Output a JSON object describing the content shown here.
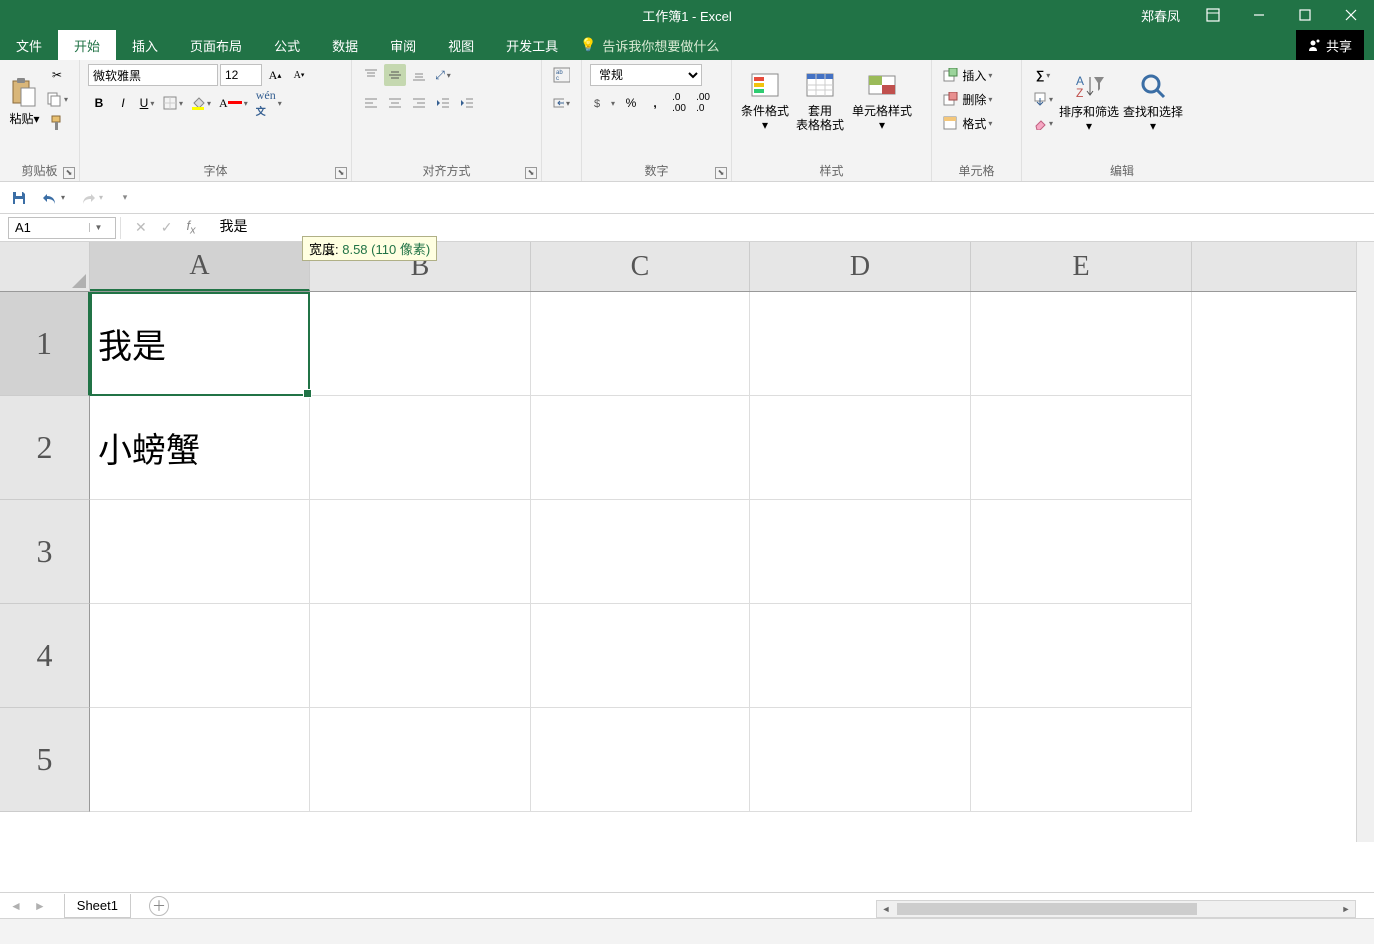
{
  "title": "工作簿1 - Excel",
  "user": "郑春凤",
  "tabs": {
    "file": "文件",
    "home": "开始",
    "insert": "插入",
    "layout": "页面布局",
    "formulas": "公式",
    "data": "数据",
    "review": "审阅",
    "view": "视图",
    "dev": "开发工具",
    "tellme": "告诉我你想要做什么"
  },
  "share": "共享",
  "ribbon": {
    "clipboard": {
      "paste": "粘贴",
      "label": "剪贴板"
    },
    "font": {
      "name": "微软雅黑",
      "size": "12",
      "label": "字体"
    },
    "align": {
      "label": "对齐方式"
    },
    "number": {
      "format": "常规",
      "label": "数字"
    },
    "styles": {
      "cond": "条件格式",
      "table": "套用\n表格格式",
      "cell": "单元格样式",
      "label": "样式"
    },
    "cells": {
      "insert": "插入",
      "delete": "删除",
      "format": "格式",
      "label": "单元格"
    },
    "editing": {
      "sort": "排序和筛选",
      "find": "查找和选择",
      "label": "编辑"
    }
  },
  "namebox": "A1",
  "formula": "我是",
  "tooltip": {
    "prefix": "宽度: ",
    "value": "8.58 (110 像素)"
  },
  "columns": [
    "A",
    "B",
    "C",
    "D",
    "E"
  ],
  "rows": [
    "1",
    "2",
    "3",
    "4",
    "5"
  ],
  "cells": {
    "A1": "我是",
    "A2": "小螃蟹"
  },
  "sheet": "Sheet1"
}
